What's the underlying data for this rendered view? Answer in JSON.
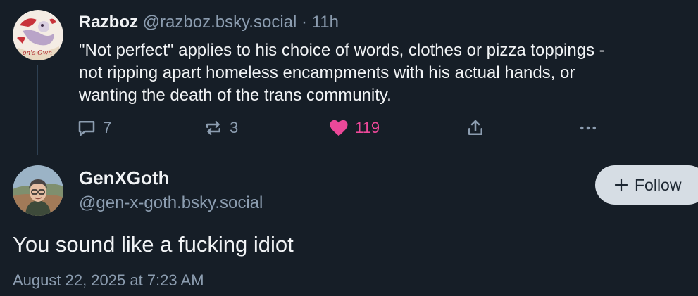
{
  "reply": {
    "display_name": "Razboz",
    "handle": "@razboz.bsky.social",
    "separator": "·",
    "time_ago": "11h",
    "text_lines": [
      "\"Not perfect\" applies to his choice of words, clothes or pizza toppings  -",
      "not ripping apart homeless encampments with his actual hands, or",
      "wanting the death of the trans community."
    ],
    "actions": {
      "reply_icon": "comment-icon",
      "reply_count": "7",
      "repost_icon": "repost-icon",
      "repost_count": "3",
      "like_icon": "heart-icon",
      "like_count": "119",
      "share_icon": "share-icon",
      "more_icon": "more-icon"
    }
  },
  "post": {
    "display_name": "GenXGoth",
    "handle": "@gen-x-goth.bsky.social",
    "follow_label": "Follow",
    "text": "You sound like a fucking idiot",
    "timestamp": "August 22, 2025 at 7:23 AM"
  },
  "colors": {
    "background": "#161e27",
    "text": "#f1f3f5",
    "muted": "#8c9db0",
    "like": "#ec4899",
    "follow_bg": "#d6dde4"
  }
}
